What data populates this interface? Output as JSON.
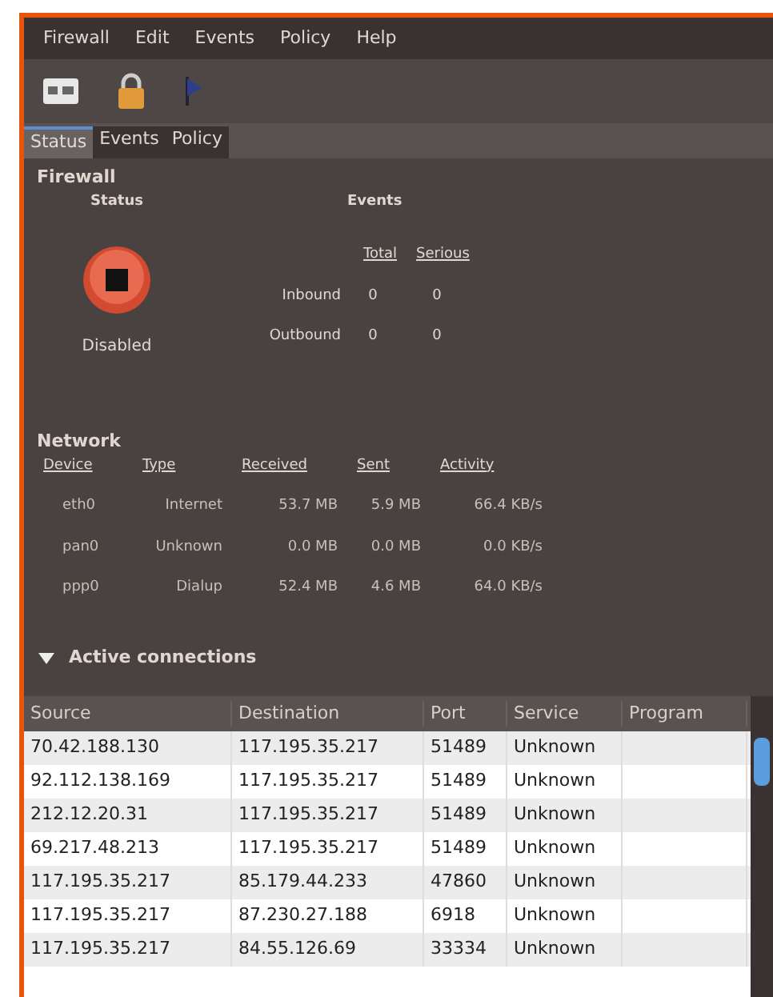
{
  "menu": [
    "Firewall",
    "Edit",
    "Events",
    "Policy",
    "Help"
  ],
  "tabs": [
    {
      "label": "Status",
      "selected": true
    },
    {
      "label": "Events",
      "selected": false
    },
    {
      "label": "Policy",
      "selected": false
    }
  ],
  "firewall": {
    "title": "Firewall",
    "status": {
      "heading": "Status",
      "state": "Disabled"
    },
    "events": {
      "heading": "Events",
      "columns": [
        "Total",
        "Serious"
      ],
      "rows": [
        {
          "label": "Inbound",
          "total": "0",
          "serious": "0"
        },
        {
          "label": "Outbound",
          "total": "0",
          "serious": "0"
        }
      ]
    }
  },
  "network": {
    "title": "Network",
    "columns": [
      "Device",
      "Type",
      "Received",
      "Sent",
      "Activity"
    ],
    "rows": [
      [
        "eth0",
        "Internet",
        "53.7 MB",
        "5.9 MB",
        "66.4 KB/s"
      ],
      [
        "pan0",
        "Unknown",
        "0.0 MB",
        "0.0 MB",
        "0.0 KB/s"
      ],
      [
        "ppp0",
        "Dialup",
        "52.4 MB",
        "4.6 MB",
        "64.0 KB/s"
      ]
    ]
  },
  "active_connections": {
    "label": "Active connections",
    "expanded": true,
    "columns": [
      "Source",
      "Destination",
      "Port",
      "Service",
      "Program"
    ],
    "rows": [
      [
        "70.42.188.130",
        "117.195.35.217",
        "51489",
        "Unknown"
      ],
      [
        "92.112.138.169",
        "117.195.35.217",
        "51489",
        "Unknown"
      ],
      [
        "212.12.20.31",
        "117.195.35.217",
        "51489",
        "Unknown"
      ],
      [
        "69.217.48.213",
        "117.195.35.217",
        "51489",
        "Unknown"
      ],
      [
        "117.195.35.217",
        "85.179.44.233",
        "47860",
        "Unknown"
      ],
      [
        "117.195.35.217",
        "87.230.27.188",
        "6918",
        "Unknown"
      ],
      [
        "117.195.35.217",
        "84.55.126.69",
        "33334",
        "Unknown"
      ]
    ]
  }
}
